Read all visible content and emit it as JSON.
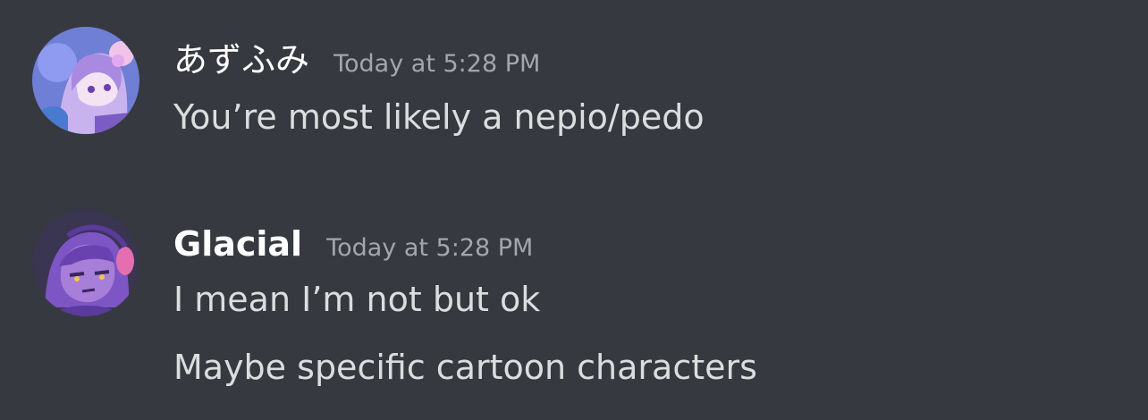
{
  "messages": [
    {
      "username": "あずふみ",
      "timestamp": "Today at 5:28 PM",
      "avatar_icon": "anime-avatar-purple-hair",
      "lines": [
        "You’re most likely a nepio/pedo"
      ]
    },
    {
      "username": "Glacial",
      "timestamp": "Today at 5:28 PM",
      "avatar_icon": "cartoon-avatar-headphones",
      "lines": [
        "I mean I’m not but ok",
        "Maybe specific cartoon characters"
      ]
    }
  ],
  "colors": {
    "background": "#36393f",
    "username": "#ffffff",
    "timestamp": "#a3a6aa",
    "message_text": "#dcddde"
  }
}
